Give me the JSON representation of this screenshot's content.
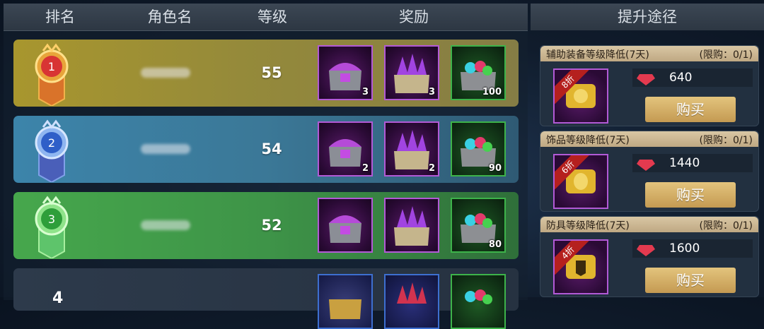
{
  "headers": {
    "rank": "排名",
    "name": "角色名",
    "level": "等级",
    "reward": "奖励",
    "upgrade": "提升途径"
  },
  "rows": [
    {
      "rank": "1",
      "level": "55",
      "rewards": [
        "3",
        "3",
        "100"
      ]
    },
    {
      "rank": "2",
      "level": "54",
      "rewards": [
        "2",
        "2",
        "90"
      ]
    },
    {
      "rank": "3",
      "level": "52",
      "rewards": [
        "",
        "",
        "80"
      ]
    },
    {
      "rank": "4",
      "level": "",
      "rewards": [
        "",
        "",
        ""
      ]
    }
  ],
  "offers": [
    {
      "title": "辅助装备等级降低(7天)",
      "limit": "(限购：0/1)",
      "discount": "8折",
      "price": "640",
      "buy": "购买"
    },
    {
      "title": "饰品等级降低(7天)",
      "limit": "(限购：0/1)",
      "discount": "6折",
      "price": "1440",
      "buy": "购买"
    },
    {
      "title": "防具等级降低(7天)",
      "limit": "(限购：0/1)",
      "discount": "4折",
      "price": "1600",
      "buy": "购买"
    }
  ],
  "colors": {
    "gold": "#a8962e",
    "blue": "#3c84aa",
    "green": "#46a74c"
  },
  "icons": {
    "medal": "rank-medal-icon",
    "chest": "treasure-chest-icon",
    "scroll": "scroll-icon",
    "gem": "ruby-gem-icon"
  }
}
